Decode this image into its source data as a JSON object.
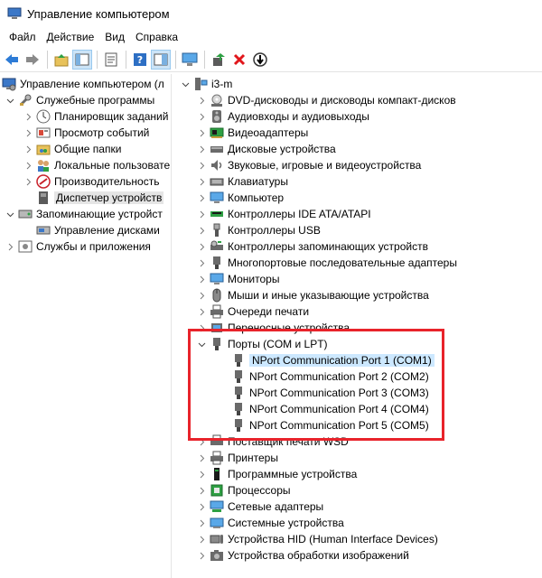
{
  "window": {
    "title": "Управление компьютером"
  },
  "menu": [
    "Файл",
    "Действие",
    "Вид",
    "Справка"
  ],
  "toolbar_icons": [
    "back-icon",
    "forward-icon",
    "up-folder-icon",
    "show-hide-console-tree-icon",
    "properties-icon",
    "help-icon",
    "view-icon",
    "monitor-scan-icon",
    "update-driver-icon",
    "uninstall-icon",
    "disable-device-icon"
  ],
  "left_tree": [
    {
      "label": "Управление компьютером (л",
      "icon": "computer-management-icon",
      "level": 0,
      "chevron": "none"
    },
    {
      "label": "Служебные программы",
      "icon": "tools-icon",
      "level": 1,
      "chevron": "down"
    },
    {
      "label": "Планировщик заданий",
      "icon": "clock-icon",
      "level": 2,
      "chevron": "right"
    },
    {
      "label": "Просмотр событий",
      "icon": "event-viewer-icon",
      "level": 2,
      "chevron": "right"
    },
    {
      "label": "Общие папки",
      "icon": "shared-folder-icon",
      "level": 2,
      "chevron": "right"
    },
    {
      "label": "Локальные пользовате",
      "icon": "users-icon",
      "level": 2,
      "chevron": "right"
    },
    {
      "label": "Производительность",
      "icon": "performance-icon",
      "level": 2,
      "chevron": "right"
    },
    {
      "label": "Диспетчер устройств",
      "icon": "device-manager-icon",
      "level": 2,
      "chevron": "none",
      "selected": true
    },
    {
      "label": "Запоминающие устройст",
      "icon": "storage-icon",
      "level": 1,
      "chevron": "down"
    },
    {
      "label": "Управление дисками",
      "icon": "disk-management-icon",
      "level": 2,
      "chevron": "none"
    },
    {
      "label": "Службы и приложения",
      "icon": "services-icon",
      "level": 1,
      "chevron": "right"
    }
  ],
  "right_tree": {
    "root": {
      "label": "i3-m",
      "icon": "computer-icon"
    },
    "categories": [
      {
        "label": "DVD-дисководы и дисководы компакт-дисков",
        "icon": "dvd-drive-icon",
        "chevron": "right"
      },
      {
        "label": "Аудиовходы и аудиовыходы",
        "icon": "speaker-icon",
        "chevron": "right"
      },
      {
        "label": "Видеоадаптеры",
        "icon": "display-adapter-icon",
        "chevron": "right"
      },
      {
        "label": "Дисковые устройства",
        "icon": "disk-drive-icon",
        "chevron": "right"
      },
      {
        "label": "Звуковые, игровые и видеоустройства",
        "icon": "sound-icon",
        "chevron": "right"
      },
      {
        "label": "Клавиатуры",
        "icon": "keyboard-icon",
        "chevron": "right"
      },
      {
        "label": "Компьютер",
        "icon": "monitor-icon",
        "chevron": "right"
      },
      {
        "label": "Контроллеры IDE ATA/ATAPI",
        "icon": "ide-controller-icon",
        "chevron": "right"
      },
      {
        "label": "Контроллеры USB",
        "icon": "usb-icon",
        "chevron": "right"
      },
      {
        "label": "Контроллеры запоминающих устройств",
        "icon": "storage-controller-icon",
        "chevron": "right"
      },
      {
        "label": "Многопортовые последовательные адаптеры",
        "icon": "multiport-adapter-icon",
        "chevron": "right"
      },
      {
        "label": "Мониторы",
        "icon": "monitor-icon",
        "chevron": "right"
      },
      {
        "label": "Мыши и иные указывающие устройства",
        "icon": "mouse-icon",
        "chevron": "right"
      },
      {
        "label": "Очереди печати",
        "icon": "print-queue-icon",
        "chevron": "right"
      },
      {
        "label": "Переносные устройства",
        "icon": "portable-device-icon",
        "chevron": "right"
      },
      {
        "label": "Порты (COM и LPT)",
        "icon": "port-icon",
        "chevron": "down",
        "children": [
          {
            "label": "NPort Communication Port 1 (COM1)",
            "icon": "port-icon",
            "selected": true
          },
          {
            "label": "NPort Communication Port 2 (COM2)",
            "icon": "port-icon"
          },
          {
            "label": "NPort Communication Port 3 (COM3)",
            "icon": "port-icon"
          },
          {
            "label": "NPort Communication Port 4 (COM4)",
            "icon": "port-icon"
          },
          {
            "label": "NPort Communication Port 5 (COM5)",
            "icon": "port-icon"
          }
        ]
      },
      {
        "label": "Поставщик печати WSD",
        "icon": "wsd-printer-icon",
        "chevron": "right"
      },
      {
        "label": "Принтеры",
        "icon": "printer-icon",
        "chevron": "right"
      },
      {
        "label": "Программные устройства",
        "icon": "software-device-icon",
        "chevron": "right"
      },
      {
        "label": "Процессоры",
        "icon": "processor-icon",
        "chevron": "right"
      },
      {
        "label": "Сетевые адаптеры",
        "icon": "network-adapter-icon",
        "chevron": "right"
      },
      {
        "label": "Системные устройства",
        "icon": "system-device-icon",
        "chevron": "right"
      },
      {
        "label": "Устройства HID (Human Interface Devices)",
        "icon": "hid-icon",
        "chevron": "right"
      },
      {
        "label": "Устройства обработки изображений",
        "icon": "camera-icon",
        "chevron": "right"
      }
    ]
  },
  "colors": {
    "highlight_border": "#e8232b",
    "selection_blue": "#cce8ff",
    "selection_gray": "#e5e5e5"
  }
}
